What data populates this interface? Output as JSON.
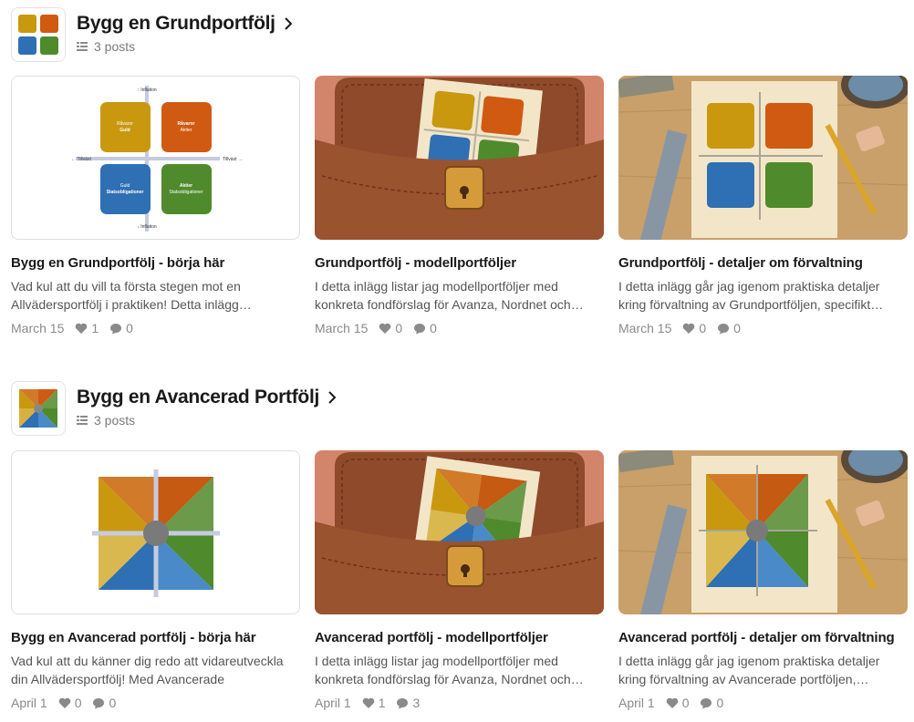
{
  "sections": [
    {
      "title": "Bygg en Grundportfölj",
      "count": "3 posts",
      "posts": [
        {
          "title": "Bygg en Grundportfölj - börja här",
          "desc": "Vad kul att du vill ta första stegen mot en Allvädersportfölj i praktiken! Detta inlägg…",
          "date": "March 15",
          "likes": "1",
          "comments": "0"
        },
        {
          "title": "Grundportfölj - modellportföljer",
          "desc": "I detta inlägg listar jag modellportföljer med konkreta fondförslag för Avanza, Nordnet och…",
          "date": "March 15",
          "likes": "0",
          "comments": "0"
        },
        {
          "title": "Grundportfölj - detaljer om förvaltning",
          "desc": "I detta inlägg går jag igenom praktiska detaljer kring förvaltning av Grundportföljen, specifikt…",
          "date": "March 15",
          "likes": "0",
          "comments": "0"
        }
      ]
    },
    {
      "title": "Bygg en Avancerad Portfölj",
      "count": "3 posts",
      "posts": [
        {
          "title": "Bygg en Avancerad portfölj - börja här",
          "desc": "Vad kul att du känner dig redo att vidareutveckla din Allvädersportfölj! Med Avancerade portföljer…",
          "date": "April 1",
          "likes": "0",
          "comments": "0"
        },
        {
          "title": "Avancerad portfölj - modellportföljer",
          "desc": "I detta inlägg listar jag modellportföljer med konkreta fondförslag för Avanza, Nordnet och…",
          "date": "April 1",
          "likes": "1",
          "comments": "3"
        },
        {
          "title": "Avancerad portfölj - detaljer om förvaltning",
          "desc": "I detta inlägg går jag igenom praktiska detaljer kring förvaltning av Avancerade portföljen,…",
          "date": "April 1",
          "likes": "0",
          "comments": "0"
        }
      ]
    }
  ],
  "diagram": {
    "inflation_up": "Inflation",
    "inflation_down": "Inflation",
    "growth_left": "Tillväxt",
    "growth_right": "Tillväxt",
    "q1_line1": "Råvaror",
    "q1_line2": "Guld",
    "q2_line1": "Råvaror",
    "q2_line2": "Aktier",
    "q3_line1": "Guld",
    "q3_line2": "Statsobligationer",
    "q4_line1": "Aktier",
    "q4_line2": "Statsobligationer"
  },
  "colors": {
    "yellow": "#c9980e",
    "orange": "#d05a12",
    "blue": "#2f6fb3",
    "green": "#4f8a2c"
  },
  "icons": {
    "chevron": "chevron-right-icon",
    "posts": "posts-list-icon",
    "like": "heart-icon",
    "comment": "comment-icon"
  }
}
